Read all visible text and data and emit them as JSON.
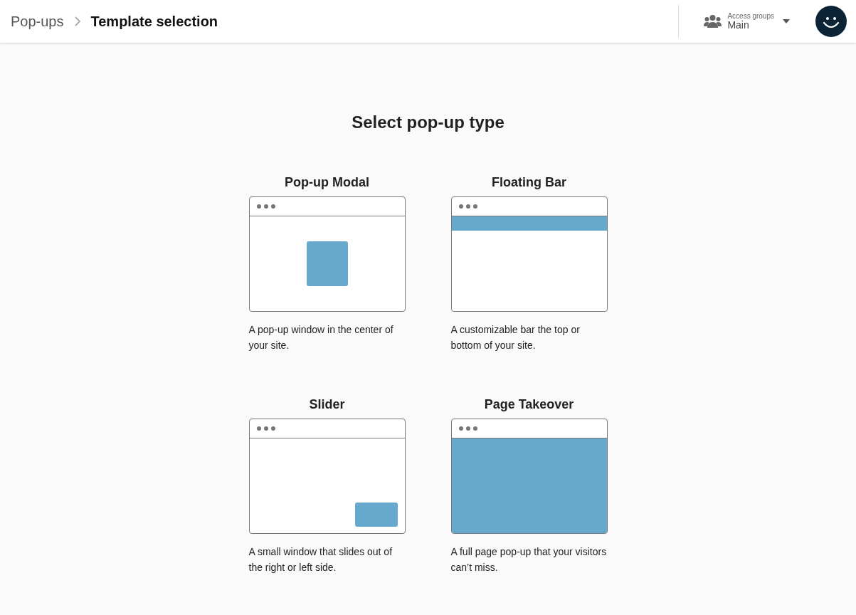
{
  "breadcrumb": [
    {
      "label": "Pop-ups",
      "current": false
    },
    {
      "label": "Template selection",
      "current": true
    }
  ],
  "access_groups": {
    "label": "Access groups",
    "value": "Main"
  },
  "heading": "Select pop-up type",
  "types": [
    {
      "kind": "modal",
      "title": "Pop-up Modal",
      "description": "A pop-up window in the center of your site."
    },
    {
      "kind": "bar",
      "title": "Floating Bar",
      "description": "A customizable bar the top or bottom of your site."
    },
    {
      "kind": "slider",
      "title": "Slider",
      "description": "A small window that slides out of the right or left side."
    },
    {
      "kind": "takeover",
      "title": "Page Takeover",
      "description": "A full page pop-up that your visitors can’t miss."
    }
  ]
}
